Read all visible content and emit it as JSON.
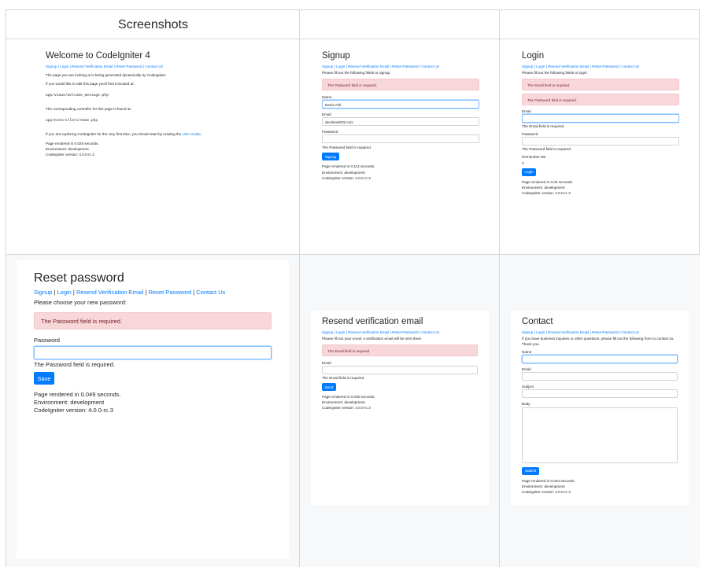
{
  "table": {
    "header": "Screenshots"
  },
  "welcome": {
    "title": "Welcome to CodeIgniter 4",
    "nav": "Signup | Login | Resend Verification Email | Reset Password | Contact Us",
    "p1": "The page you are looking at is being generated dynamically by CodeIgniter.",
    "p2": "If you would like to edit this page you'll find it located at:",
    "path1": "app/Views/welcome_message.php",
    "p3": "The corresponding controller for this page is found at:",
    "path2": "app/Controllers/Home.php",
    "p4_prefix": "If you are exploring CodeIgniter for the very first time, you should start by reading the ",
    "p4_link": "User Guide",
    "p4_suffix": ".",
    "f1": "Page rendered in 0.025 seconds.",
    "f2": "Environment: development",
    "f3": "CodeIgniter version: 4.0.0-rc.3"
  },
  "signup": {
    "title": "Signup",
    "nav": "Signup | Login | Resend Verification Email | Reset Password | Contact Us",
    "intro": "Please fill out the following fields to signup:",
    "alert": "The Password field is required.",
    "name_label": "Name",
    "name_value": "Denis Ahli",
    "email_label": "Email",
    "email_value": "devdenis002.com",
    "password_label": "Password",
    "password_error": "The Password field is required.",
    "button": "Signup",
    "f1": "Page rendered in 0.114 seconds.",
    "f2": "Environment: development",
    "f3": "CodeIgniter version: 4.0.0-rc.3"
  },
  "login": {
    "title": "Login",
    "nav": "Signup | Login | Resend Verification Email | Reset Password | Contact Us",
    "intro": "Please fill out the following fields to login:",
    "alert1": "The Email field is required.",
    "alert2": "The Password field is required.",
    "email_label": "Email",
    "email_error": "The Email field is required.",
    "password_label": "Password",
    "password_error": "The Password field is required.",
    "remember_label": "Remember Me",
    "remember_value": "0",
    "button": "Login",
    "f1": "Page rendered in 0.03 seconds.",
    "f2": "Environment: development",
    "f3": "CodeIgniter version: 4.0.0-rc.3"
  },
  "reset": {
    "title": "Reset password",
    "nav_items": [
      "Signup",
      "Login",
      "Resend Verification Email",
      "Reset Password",
      "Contact Us"
    ],
    "nav_sep": " | ",
    "intro": "Please choose your new password:",
    "alert": "The Password field is required.",
    "password_label": "Password",
    "password_error": "The Password field is required.",
    "button": "Save",
    "f1": "Page rendered in 0.049 seconds.",
    "f2": "Environment: development",
    "f3": "CodeIgniter version: 4.0.0-rc.3"
  },
  "resend": {
    "title": "Resend verification email",
    "nav": "Signup | Login | Resend Verification Email | Reset Password | Contact Us",
    "intro": "Please fill out your email. A verification email will be sent there.",
    "alert": "The Email field is required.",
    "email_label": "Email",
    "email_error": "The Email field is required.",
    "button": "Send",
    "f1": "Page rendered in 0.035 seconds.",
    "f2": "Environment: development",
    "f3": "CodeIgniter version: 4.0.0-rc.3"
  },
  "contact": {
    "title": "Contact",
    "nav": "Signup | Login | Resend Verification Email | Reset Password | Contact Us",
    "intro": "If you have business inquiries or other questions, please fill out the following form to contact us. Thank you.",
    "name_label": "Name",
    "email_label": "Email",
    "subject_label": "Subject",
    "body_label": "Body",
    "button": "Submit",
    "f1": "Page rendered in 0.034 seconds.",
    "f2": "Environment: development",
    "f3": "CodeIgniter version: 4.0.0-rc.3"
  },
  "colors": {
    "primary": "#007bff",
    "alert_bg": "#f8d7da",
    "alert_text": "#721c24",
    "cell_gray": "#f6f8fa",
    "border": "#d0d7de"
  }
}
